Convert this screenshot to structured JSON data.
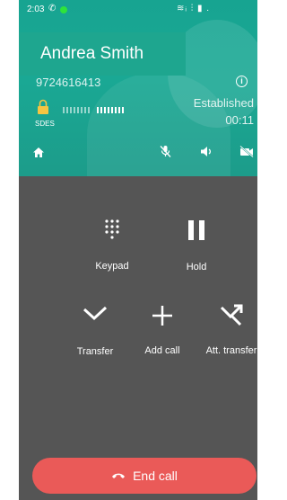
{
  "status_bar": {
    "time": "2:03",
    "right_icons": "≋ᵢ ⫶ ▮ ."
  },
  "call": {
    "name": "Andrea Smith",
    "number": "9724616413",
    "state": "Established",
    "duration": "00:11",
    "security_label": "SDES"
  },
  "actions": {
    "keypad": "Keypad",
    "hold": "Hold",
    "transfer": "Transfer",
    "add_call": "Add call",
    "att_transfer": "Att. transfer",
    "end_call": "End call"
  },
  "colors": {
    "header": "#1aa894",
    "panel": "#555555",
    "end_call": "#ea5a58"
  }
}
